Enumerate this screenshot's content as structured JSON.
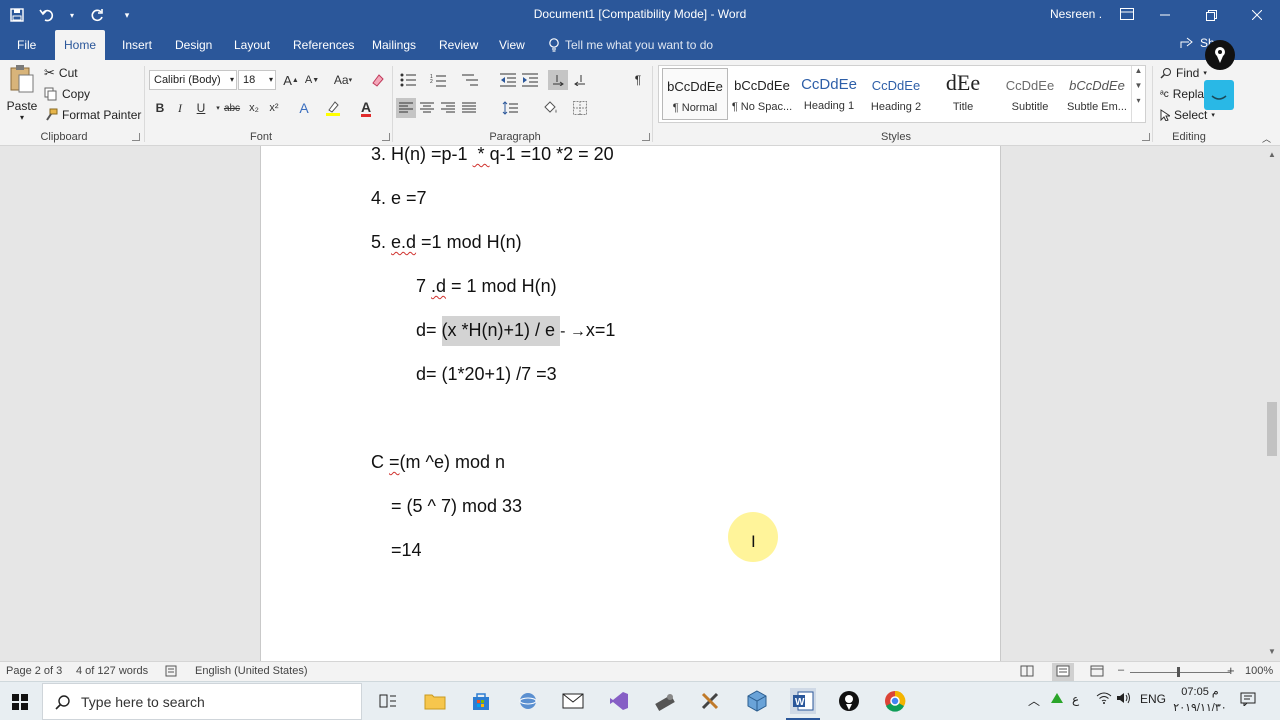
{
  "title_bar": {
    "title": "Document1 [Compatibility Mode]  -  Word",
    "user": "Nesreen ."
  },
  "tabs": [
    "File",
    "Home",
    "Insert",
    "Design",
    "Layout",
    "References",
    "Mailings",
    "Review",
    "View"
  ],
  "active_tab": "Home",
  "tell_me": "Tell me what you want to do",
  "share_label": "Sh",
  "clipboard": {
    "paste": "Paste",
    "cut": "Cut",
    "copy": "Copy",
    "format_painter": "Format Painter",
    "group_label": "Clipboard"
  },
  "font": {
    "name": "Calibri (Body)",
    "size": "18",
    "group_label": "Font",
    "bold": "B",
    "italic": "I",
    "underline": "U",
    "strike": "abc",
    "subscript": "x₂",
    "superscript": "x²",
    "grow": "A",
    "shrink": "A",
    "change_case": "Aa",
    "effects": "A",
    "font_color": "A"
  },
  "paragraph": {
    "group_label": "Paragraph",
    "pilcrow": "¶"
  },
  "styles": {
    "group_label": "Styles",
    "items": [
      {
        "preview": "bCcDdEe",
        "name": "¶ Normal"
      },
      {
        "preview": "bCcDdEe",
        "name": "¶ No Spac..."
      },
      {
        "preview": "CcDdEe",
        "name": "Heading 1"
      },
      {
        "preview": "CcDdEe",
        "name": "Heading 2"
      },
      {
        "preview": "dEe",
        "name": "Title"
      },
      {
        "preview": "CcDdEe",
        "name": "Subtitle"
      },
      {
        "preview": "bCcDdEe",
        "name": "Subtle Em..."
      }
    ]
  },
  "editing": {
    "find": "Find",
    "replace": "Repla",
    "select": "Select",
    "group_label": "Editing"
  },
  "document": {
    "line1_pre": "3. H(n) =p-1 ",
    "line1_sq": " * ",
    "line1_post": "q-1 =10 *2 = 20",
    "line2": "4. e =7",
    "line3_pre": "5. ",
    "line3_sq": "e.d",
    "line3_post": " =1 mod H(n)",
    "line4_pre": "7 ",
    "line4_sq": ".d",
    "line4_post": " = 1 mod H(n)",
    "line5_pre": "d= ",
    "line5_hl": "(x *H(n)+1) / e ",
    "line5_arrow": "- →",
    "line5_post": "x=1",
    "line6": "d= (1*20+1) /7 =3",
    "line7_pre": "C ",
    "line7_sq": "=",
    "line7_post": "(m ^e) mod n",
    "line8": "= (5 ^ 7) mod 33",
    "line9": "=14"
  },
  "status": {
    "page": "Page 2 of 3",
    "words": "4 of 127 words",
    "language": "English (United States)",
    "zoom": "100%"
  },
  "taskbar": {
    "search_placeholder": "Type here to search",
    "lang": "ENG",
    "time": "07:05 م",
    "date": "٢٠١٩/١١/٣٠"
  }
}
